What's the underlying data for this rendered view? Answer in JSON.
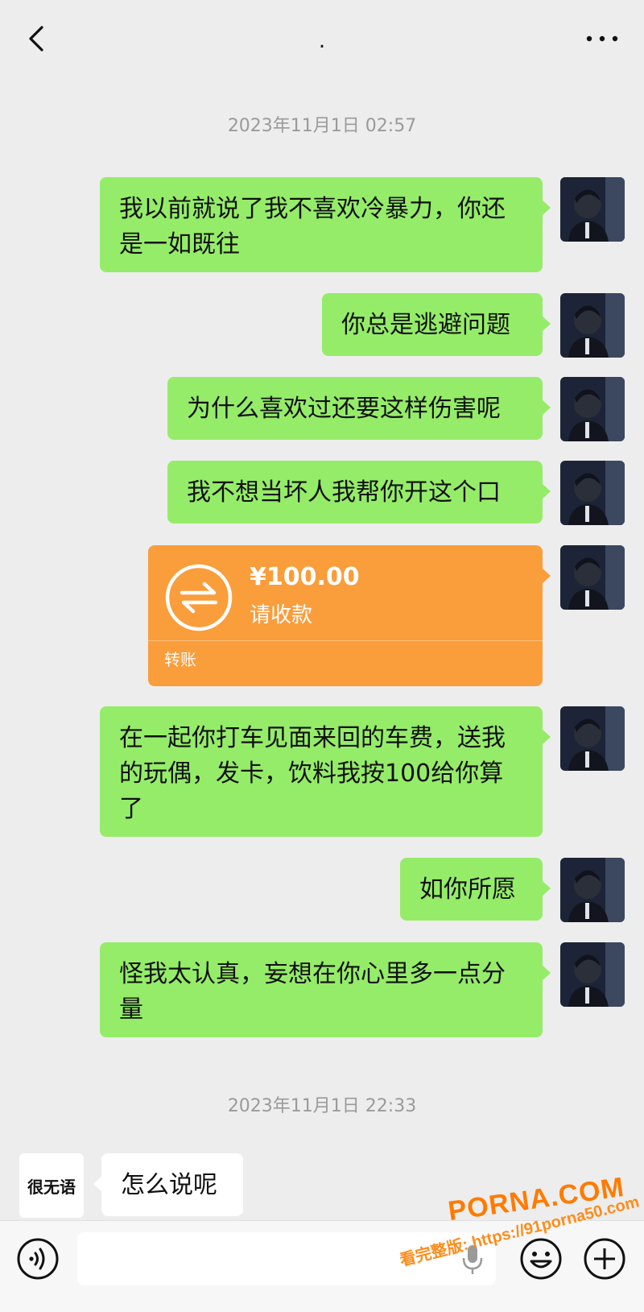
{
  "header": {
    "title": "."
  },
  "timestamps": [
    "2023年11月1日 02:57",
    "2023年11月1日 22:33"
  ],
  "messages": {
    "m1": "我以前就说了我不喜欢冷暴力，你还",
    "m1b": "是一如既往",
    "m2": "你总是逃避问题",
    "m3": "为什么喜欢过还要这样伤害呢",
    "m4": "我不想当坏人我帮你开这个口",
    "m6a": "在一起你打车见面来回的车费，送我",
    "m6b": "的玩偶，发卡，饮料我按100给你算",
    "m6c": "了",
    "m7": "如你所愿",
    "m8a": "怪我太认真，妄想在你心里多一点分",
    "m8b": "量",
    "m9": "怎么说呢"
  },
  "transfer": {
    "amount": "¥100.00",
    "status": "请收款",
    "label": "转账"
  },
  "contact": {
    "avatar_text": "很无语"
  },
  "watermark": {
    "logo": "PORNA.COM",
    "url": "看完整版: https://91porna50.com"
  },
  "colors": {
    "sent_bubble": "#95ec69",
    "received_bubble": "#ffffff",
    "transfer": "#fa9d3b",
    "background": "#ededed"
  },
  "icons": [
    "back-icon",
    "more-icon",
    "transfer-icon",
    "voice-icon",
    "mic-icon",
    "emoji-icon",
    "plus-icon"
  ]
}
